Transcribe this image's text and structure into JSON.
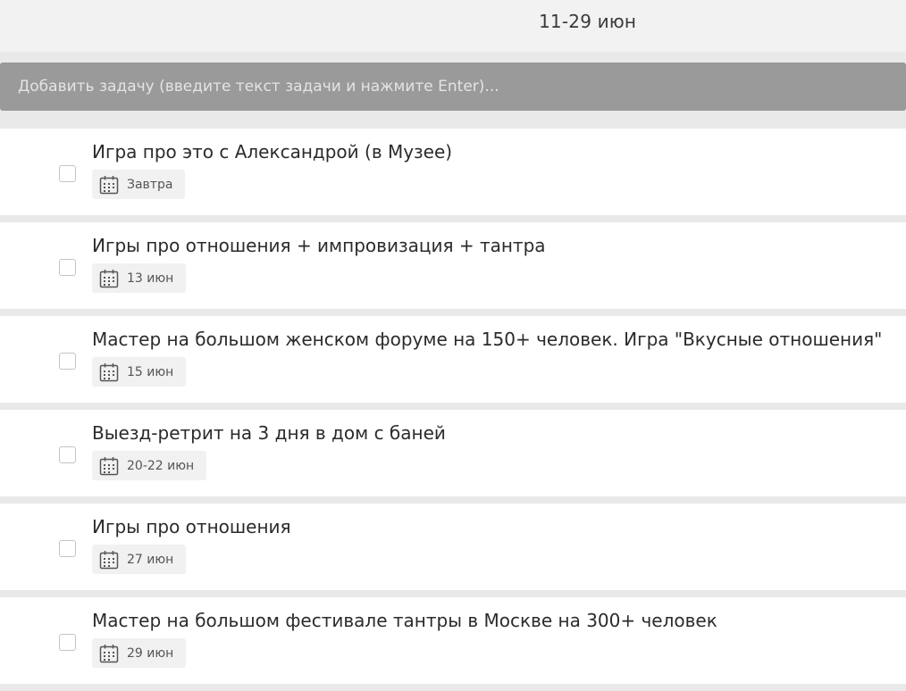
{
  "header": {
    "date_range": "11-29 июн"
  },
  "add_task": {
    "placeholder": "Добавить задачу (введите текст задачи и нажмите Enter)..."
  },
  "tasks": [
    {
      "title": "Игра про это с Александрой (в Музее)",
      "date": "Завтра",
      "icon": "calendar-icon"
    },
    {
      "title": "Игры про отношения + импровизация + тантра",
      "date": "13 июн",
      "icon": "calendar-icon"
    },
    {
      "title": "Мастер на большом женском форуме на 150+ человек. Игра \"Вкусные отношения\"",
      "date": "15 июн",
      "icon": "calendar-icon"
    },
    {
      "title": "Выезд-ретрит на 3 дня в дом с баней",
      "date": "20-22 июн",
      "icon": "calendar-icon"
    },
    {
      "title": "Игры про отношения",
      "date": "27 июн",
      "icon": "calendar-icon"
    },
    {
      "title": "Мастер на большом фестивале тантры в Москве на 300+ человек",
      "date": "29 июн",
      "icon": "calendar-icon"
    }
  ],
  "colors": {
    "background": "#e9e9e9",
    "add_task_bar": "#9a9a9a",
    "task_card": "#ffffff",
    "date_chip": "#f1f1f1",
    "checkbox_border": "#c4c4c4",
    "text": "#2b2b2b"
  }
}
